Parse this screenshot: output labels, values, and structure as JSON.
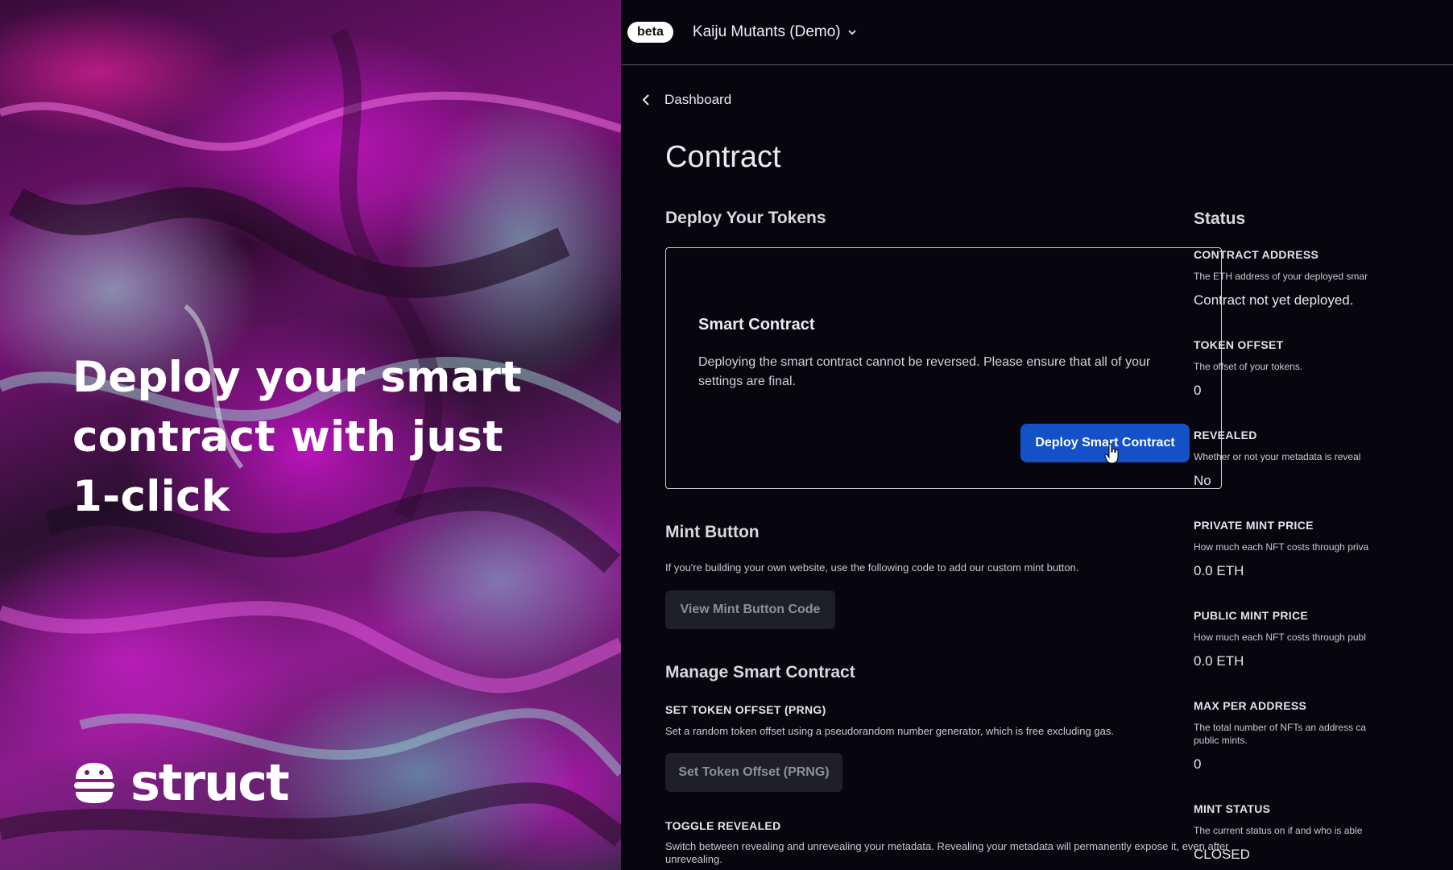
{
  "hero": {
    "headline": "Deploy your smart contract with just 1-click",
    "brand_name": "struct"
  },
  "topbar": {
    "badge": "beta",
    "project_name": "Kaiju Mutants (Demo)"
  },
  "nav": {
    "back_label": "Dashboard"
  },
  "page": {
    "title": "Contract"
  },
  "deploy": {
    "section_title": "Deploy Your Tokens",
    "card_title": "Smart Contract",
    "card_text": "Deploying the smart contract cannot be reversed. Please ensure that all of your settings are final.",
    "button_label": "Deploy Smart Contract"
  },
  "mint": {
    "section_title": "Mint Button",
    "description": "If you're building your own website, use the following code to add our custom mint button.",
    "button_label": "View Mint Button Code"
  },
  "manage": {
    "section_title": "Manage Smart Contract",
    "offset_label": "SET TOKEN OFFSET (PRNG)",
    "offset_desc": "Set a random token offset using a pseudorandom number generator, which is free excluding gas.",
    "offset_button": "Set Token Offset (PRNG)",
    "reveal_label": "TOGGLE REVEALED",
    "reveal_desc": "Switch between revealing and unrevealing your metadata. Revealing your metadata will permanently expose it, even after unrevealing."
  },
  "status": {
    "title": "Status",
    "items": [
      {
        "label": "CONTRACT ADDRESS",
        "desc": "The ETH address of your deployed smar",
        "value": "Contract not yet deployed."
      },
      {
        "label": "TOKEN OFFSET",
        "desc": "The offset of your tokens.",
        "value": "0"
      },
      {
        "label": "REVEALED",
        "desc": "Whether or not your metadata is reveal",
        "value": "No"
      },
      {
        "label": "PRIVATE MINT PRICE",
        "desc": "How much each NFT costs through priva",
        "value": "0.0 ETH"
      },
      {
        "label": "PUBLIC MINT PRICE",
        "desc": "How much each NFT costs through publ",
        "value": "0.0 ETH"
      },
      {
        "label": "MAX PER ADDRESS",
        "desc": "The total number of NFTs an address ca",
        "desc2": "public mints.",
        "value": "0"
      },
      {
        "label": "MINT STATUS",
        "desc": "The current status on if and who is able",
        "value": "CLOSED"
      }
    ]
  },
  "colors": {
    "accent": "#1450c8",
    "background": "#07060f",
    "hero_magenta": "#c21fc4",
    "hero_teal": "#8fd8d8"
  }
}
